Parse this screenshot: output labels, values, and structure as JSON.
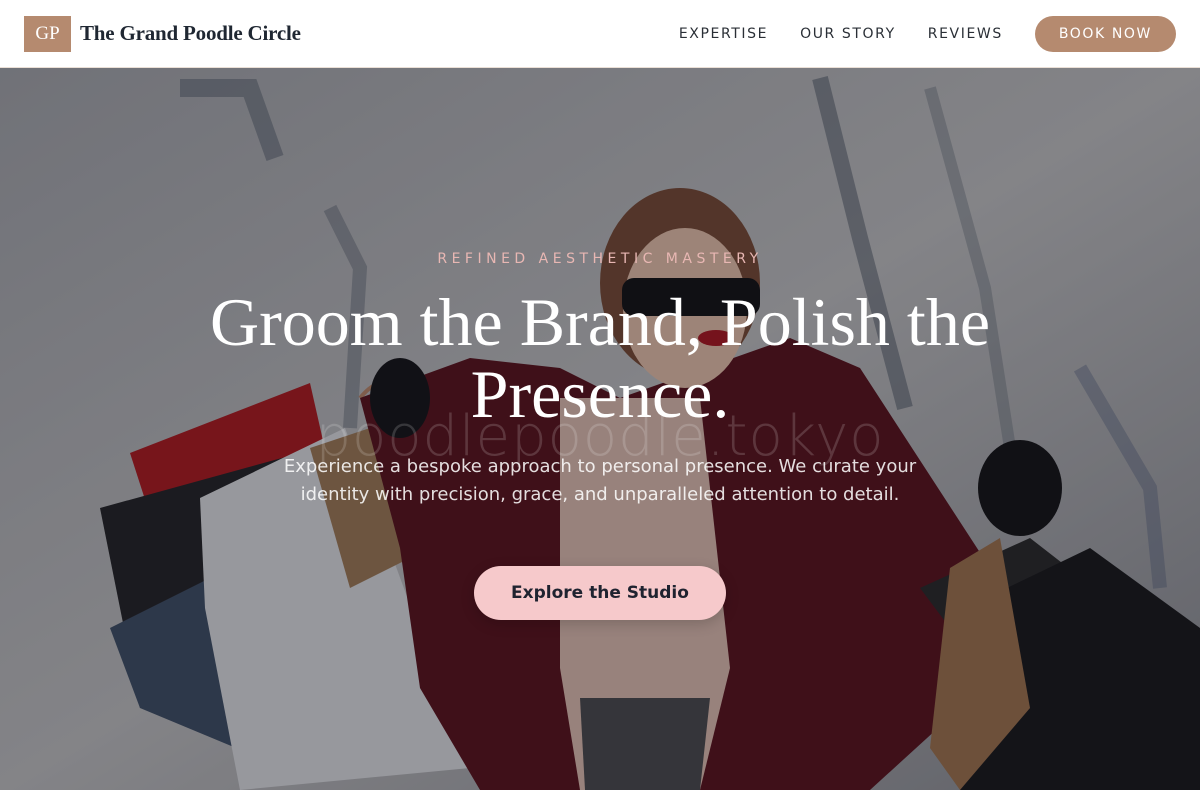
{
  "header": {
    "logo_mark": "GP",
    "brand_name": "The Grand Poodle Circle",
    "nav": [
      {
        "label": "EXPERTISE"
      },
      {
        "label": "OUR STORY"
      },
      {
        "label": "REVIEWS"
      }
    ],
    "cta_label": "BOOK NOW"
  },
  "hero": {
    "eyebrow": "REFINED AESTHETIC MASTERY",
    "headline": "Groom the Brand, Polish the Presence.",
    "watermark": "poodlepoodle.tokyo",
    "lead": "Experience a bespoke approach to personal presence. We curate your identity with precision, grace, and unparalleled attention to detail.",
    "cta_label": "Explore the Studio"
  },
  "colors": {
    "accent": "#b58a6f",
    "cta_pink": "#f6c9cb",
    "eyebrow_pink": "#e8b7b3"
  }
}
